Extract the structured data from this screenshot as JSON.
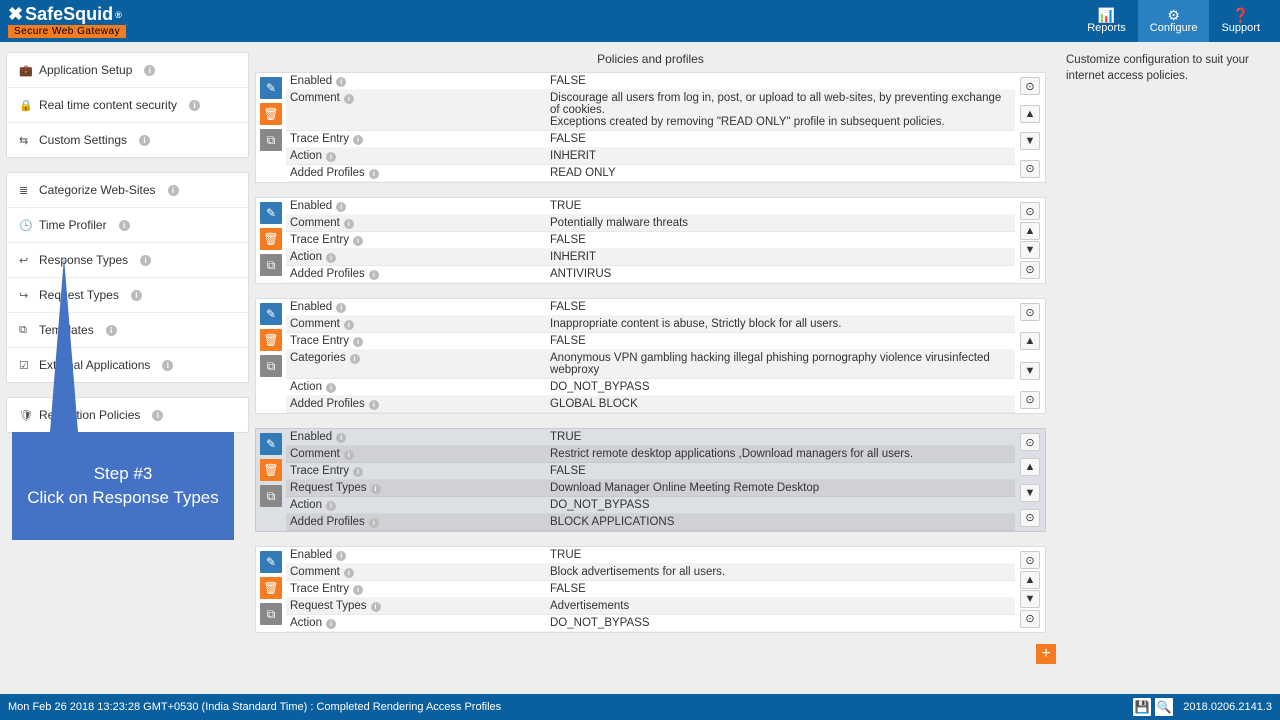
{
  "brand": {
    "name": "SafeSquid",
    "trademark": "®",
    "tagline": "Secure Web Gateway"
  },
  "topnav": {
    "reports": "Reports",
    "configure": "Configure",
    "support": "Support"
  },
  "sidebar": {
    "group1": [
      {
        "icon": "briefcase-icon",
        "glyph": "💼",
        "label": "Application Setup"
      },
      {
        "icon": "lock-icon",
        "glyph": "🔒",
        "label": "Real time content security"
      },
      {
        "icon": "sliders-icon",
        "glyph": "⇆",
        "label": "Custom Settings"
      }
    ],
    "group2": [
      {
        "icon": "list-icon",
        "glyph": "≣",
        "label": "Categorize Web-Sites"
      },
      {
        "icon": "clock-icon",
        "glyph": "🕒",
        "label": "Time Profiler"
      },
      {
        "icon": "reply-icon",
        "glyph": "↩",
        "label": "Response Types"
      },
      {
        "icon": "share-icon",
        "glyph": "↪",
        "label": "Request Types"
      },
      {
        "icon": "template-icon",
        "glyph": "⧉",
        "label": "Templates"
      },
      {
        "icon": "check-icon",
        "glyph": "☑",
        "label": "External Applications"
      }
    ],
    "group3": [
      {
        "icon": "shield-icon",
        "glyph": "🛡",
        "label": "Restriction Policies"
      }
    ]
  },
  "page_title": "Policies and profiles",
  "right_panel": "Customize configuration to suit your internet access policies.",
  "labels": {
    "enabled": "Enabled",
    "comment": "Comment",
    "trace": "Trace Entry",
    "action": "Action",
    "added": "Added Profiles",
    "categories": "Categories",
    "reqtypes": "Request Types"
  },
  "policies": [
    {
      "rows": [
        {
          "k": "enabled",
          "v": "FALSE"
        },
        {
          "k": "comment",
          "v": "Discourage all users from log in, post, or upload to all web-sites, by preventing exchange of cookies.\nExceptions created by removing \"READ ONLY\" profile in subsequent policies."
        },
        {
          "k": "trace",
          "v": "FALSE"
        },
        {
          "k": "action",
          "v": "INHERIT"
        },
        {
          "k": "added",
          "v": "READ ONLY"
        }
      ]
    },
    {
      "rows": [
        {
          "k": "enabled",
          "v": "TRUE"
        },
        {
          "k": "comment",
          "v": "Potentially malware threats"
        },
        {
          "k": "trace",
          "v": "FALSE"
        },
        {
          "k": "action",
          "v": "INHERIT"
        },
        {
          "k": "added",
          "v": "ANTIVIRUS"
        }
      ]
    },
    {
      "rows": [
        {
          "k": "enabled",
          "v": "FALSE"
        },
        {
          "k": "comment",
          "v": "Inappropriate content is abuse, Strictly block for all users."
        },
        {
          "k": "trace",
          "v": "FALSE"
        },
        {
          "k": "categories",
          "v": "Anonymous VPN  gambling  hacking  illegal  phishing  pornography  violence  virusinfected  webproxy"
        },
        {
          "k": "action",
          "v": "DO_NOT_BYPASS"
        },
        {
          "k": "added",
          "v": "GLOBAL BLOCK"
        }
      ]
    },
    {
      "highlight": true,
      "rows": [
        {
          "k": "enabled",
          "v": "TRUE"
        },
        {
          "k": "comment",
          "v": "Restrict remote desktop applications ,Download managers for all users."
        },
        {
          "k": "trace",
          "v": "FALSE"
        },
        {
          "k": "reqtypes",
          "v": "Download Manager  Online Meeting  Remote Desktop"
        },
        {
          "k": "action",
          "v": "DO_NOT_BYPASS"
        },
        {
          "k": "added",
          "v": "BLOCK APPLICATIONS"
        }
      ]
    },
    {
      "rows": [
        {
          "k": "enabled",
          "v": "TRUE"
        },
        {
          "k": "comment",
          "v": "Block advertisements for all users."
        },
        {
          "k": "trace",
          "v": "FALSE"
        },
        {
          "k": "reqtypes",
          "v": "Advertisements"
        },
        {
          "k": "action",
          "v": "DO_NOT_BYPASS"
        }
      ]
    }
  ],
  "callout": {
    "title": "Step #3",
    "body": "Click on Response Types"
  },
  "footer": {
    "status": "Mon Feb 26 2018 13:23:28 GMT+0530 (India Standard Time) : Completed Rendering Access Profiles",
    "version": "2018.0206.2141.3"
  }
}
